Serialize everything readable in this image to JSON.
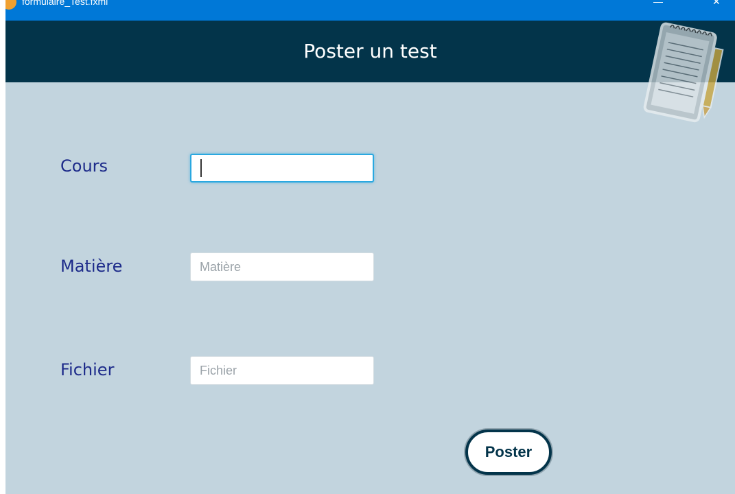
{
  "window": {
    "title": "formulaire_Test.fxml",
    "controls": [
      "—",
      "✕"
    ]
  },
  "header": {
    "title": "Poster un test"
  },
  "form": {
    "cours": {
      "label": "Cours",
      "value": "",
      "placeholder": ""
    },
    "matiere": {
      "label": "Matière",
      "value": "",
      "placeholder": "Matière"
    },
    "fichier": {
      "label": "Fichier",
      "value": "",
      "placeholder": "Fichier"
    }
  },
  "actions": {
    "submit_label": "Poster"
  },
  "colors": {
    "titlebar": "#0078d7",
    "header": "#03344a",
    "background": "#c2d4de",
    "label": "#1d2b8a",
    "focus": "#2aa8e0"
  },
  "icons": {
    "app": "java-app-icon",
    "decoration": "notepad-pencil-icon"
  }
}
